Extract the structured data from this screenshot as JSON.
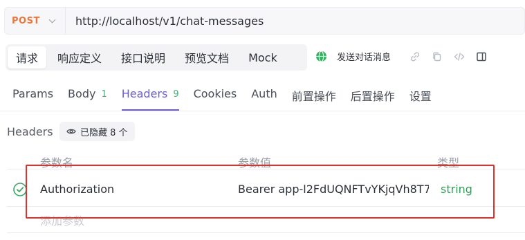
{
  "request": {
    "method": "POST",
    "url": "http://localhost/v1/chat-messages"
  },
  "top_tabs": [
    {
      "label": "请求",
      "active": true
    },
    {
      "label": "响应定义",
      "active": false
    },
    {
      "label": "接口说明",
      "active": false
    },
    {
      "label": "预览文档",
      "active": false
    },
    {
      "label": "Mock",
      "active": false
    }
  ],
  "api_name": "发送对话消息",
  "toolbar_icons": [
    "link-icon",
    "copy-icon",
    "code-icon",
    "panel-icon"
  ],
  "sub_tabs": [
    {
      "label": "Params",
      "count": ""
    },
    {
      "label": "Body",
      "count": "1"
    },
    {
      "label": "Headers",
      "count": "9",
      "active": true
    },
    {
      "label": "Cookies",
      "count": ""
    },
    {
      "label": "Auth",
      "count": ""
    },
    {
      "label": "前置操作",
      "count": ""
    },
    {
      "label": "后置操作",
      "count": ""
    },
    {
      "label": "设置",
      "count": ""
    }
  ],
  "headers_section": {
    "label": "Headers",
    "hidden_chip": "已隐藏 8 个"
  },
  "table": {
    "columns": [
      "参数名",
      "参数值",
      "类型"
    ],
    "rows": [
      {
        "name": "Authorization",
        "value": "Bearer app-l2FdUQNFTvYKjqVh8T7(",
        "type": "string",
        "enabled": true
      }
    ],
    "add_placeholder": "添加参数"
  },
  "colors": {
    "method": "#e8793a",
    "accent": "#6b5cd6",
    "count": "#4caf7a",
    "type": "#3a9a5c",
    "highlight": "#e0302c"
  }
}
